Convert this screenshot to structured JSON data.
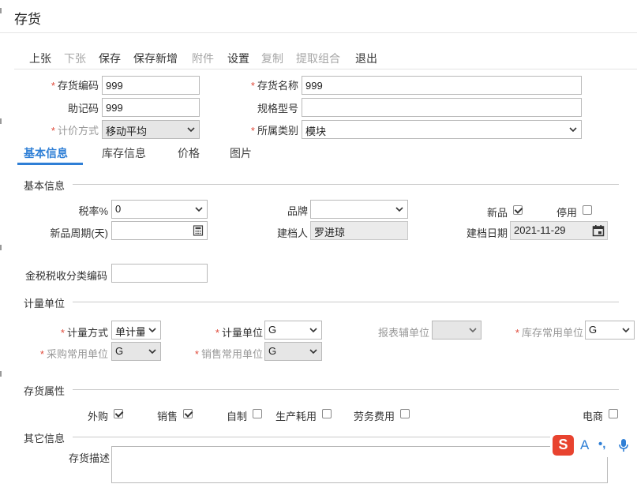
{
  "window": {
    "title": "存货"
  },
  "toolbar": {
    "prev": "上张",
    "next": "下张",
    "save": "保存",
    "save_new": "保存新增",
    "attach": "附件",
    "settings": "设置",
    "copy": "复制",
    "extract": "提取组合",
    "exit": "退出"
  },
  "header_form": {
    "code_label": "存货编码",
    "code_value": "999",
    "name_label": "存货名称",
    "name_value": "999",
    "mnemonic_label": "助记码",
    "mnemonic_value": "999",
    "spec_label": "规格型号",
    "spec_value": "",
    "pricing_label": "计价方式",
    "pricing_value": "移动平均",
    "category_label": "所属类别",
    "category_value": "模块"
  },
  "tabs": {
    "basic": "基本信息",
    "stock": "库存信息",
    "price": "价格",
    "image": "图片"
  },
  "basic_section": {
    "title": "基本信息",
    "tax_label": "税率%",
    "tax_value": "0",
    "brand_label": "品牌",
    "brand_value": "",
    "new_label": "新品",
    "new_checked": true,
    "disable_label": "停用",
    "disable_checked": false,
    "period_label": "新品周期(天)",
    "period_value": "",
    "creator_label": "建档人",
    "creator_value": "罗进琼",
    "date_label": "建档日期",
    "date_value": "2021-11-29",
    "taxcode_label": "金税税收分类编码",
    "taxcode_value": ""
  },
  "unit_section": {
    "title": "计量单位",
    "method_label": "计量方式",
    "method_value": "单计量",
    "unit_label": "计量单位",
    "unit_value": "G",
    "report_label": "报表辅单位",
    "report_value": "",
    "stock_unit_label": "库存常用单位",
    "stock_unit_value": "G",
    "purchase_label": "采购常用单位",
    "purchase_value": "G",
    "sales_label": "销售常用单位",
    "sales_value": "G"
  },
  "attr_section": {
    "title": "存货属性",
    "outsource_label": "外购",
    "outsource_checked": true,
    "sales_label": "销售",
    "sales_checked": true,
    "selfmade_label": "自制",
    "selfmade_checked": false,
    "production_label": "生产耗用",
    "production_checked": false,
    "labor_label": "劳务费用",
    "labor_checked": false,
    "ecom_label": "电商",
    "ecom_checked": false
  },
  "other_section": {
    "title": "其它信息",
    "desc_label": "存货描述",
    "desc_value": ""
  },
  "ime": {
    "mode_letter": "A",
    "punct": "•,",
    "brand_letter": "S"
  },
  "colors": {
    "accent": "#2f7fd6",
    "required": "#e04a3a",
    "ime_red": "#e8432f",
    "ime_blue": "#2f7fd6"
  }
}
